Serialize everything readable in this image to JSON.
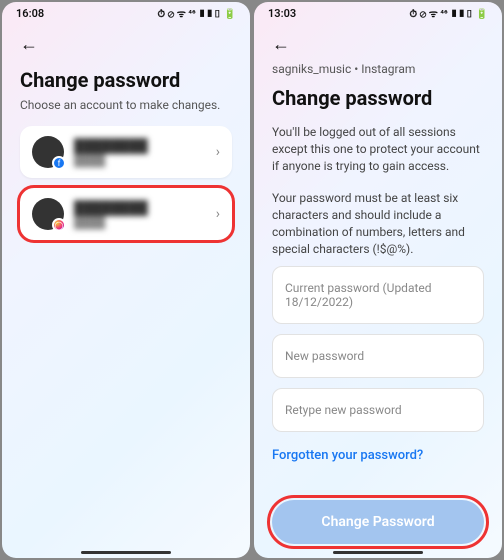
{
  "left": {
    "status_time": "16:08",
    "status_icons": "⏱ ⊘ ᯤ ⁴⁶ ▮▮▯ 🔋",
    "title": "Change password",
    "subtitle": "Choose an account to make changes.",
    "accounts": [
      {
        "name": "████████",
        "sub": "████",
        "badge": "fb"
      },
      {
        "name": "████████",
        "sub": "████",
        "badge": "ig"
      }
    ]
  },
  "right": {
    "status_time": "13:03",
    "status_icons": "⏱ ⊘ ᯤ ⁴⁶ ▮▮▯ 🔋",
    "breadcrumb": "sagniks_music • Instagram",
    "title": "Change password",
    "desc1": "You'll be logged out of all sessions except this one to protect your account if anyone is trying to gain access.",
    "desc2": "Your password must be at least six characters and should include a combination of numbers, letters and special characters (!$@%).",
    "fields": {
      "current": "Current password (Updated 18/12/2022)",
      "new": "New password",
      "retype": "Retype new password"
    },
    "forgot": "Forgotten your password?",
    "button": "Change Password"
  }
}
